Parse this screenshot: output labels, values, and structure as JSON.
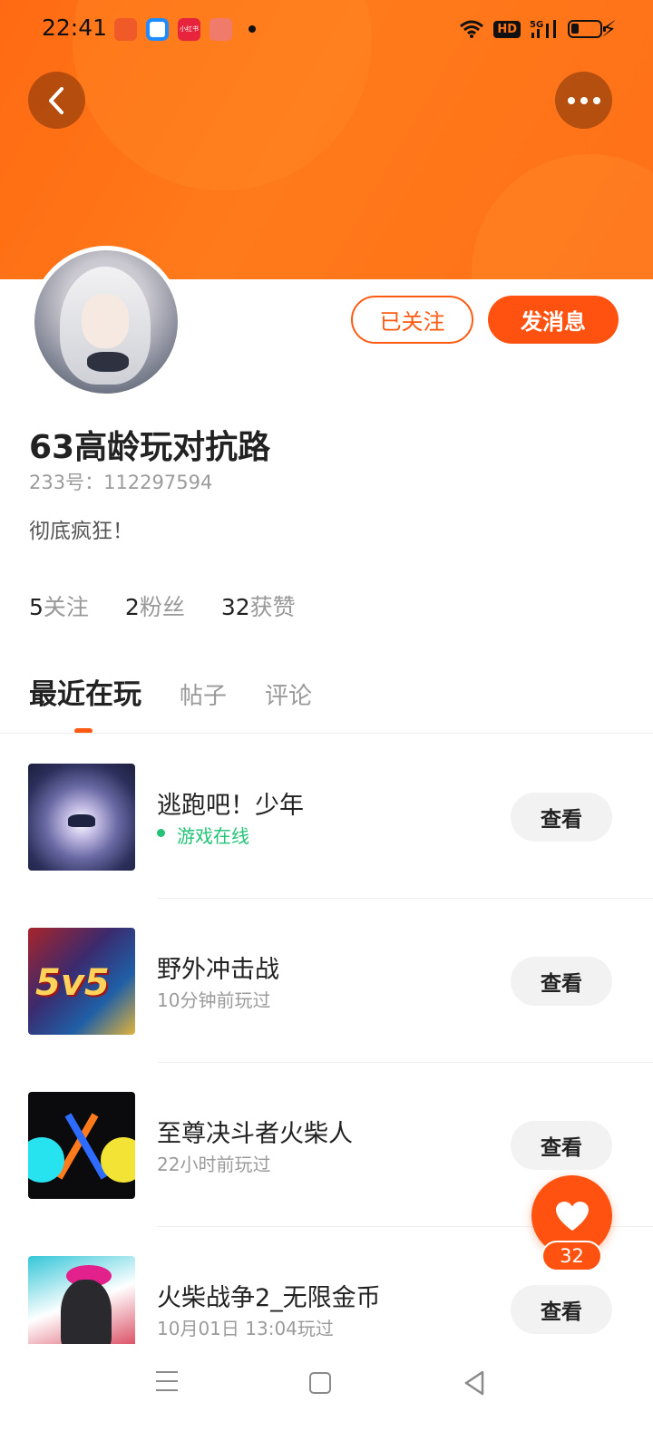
{
  "status_bar": {
    "time": "22:41",
    "notification_icons": [
      "kuaishou-icon",
      "browser-icon",
      "xiaohongshu-icon",
      "reader-icon"
    ],
    "notification_badge_text": "小红书",
    "hd_label": "HD",
    "network_label": "5G"
  },
  "header": {
    "back_icon": "chevron-left-icon",
    "more_icon": "more-dots-icon",
    "banner_color": "#ff7418"
  },
  "profile": {
    "username": "63高龄玩对抗路",
    "uid_text": "233号：112297594",
    "bio": "彻底疯狂！",
    "follow_button": "已关注",
    "message_button": "发消息",
    "stats": [
      {
        "num": "5",
        "label": "关注"
      },
      {
        "num": "2",
        "label": "粉丝"
      },
      {
        "num": "32",
        "label": "获赞"
      }
    ]
  },
  "tabs": [
    {
      "label": "最近在玩",
      "active": true
    },
    {
      "label": "帖子",
      "active": false
    },
    {
      "label": "评论",
      "active": false
    }
  ],
  "games": [
    {
      "title": "逃跑吧！少年",
      "subtitle": "游戏在线",
      "online": true,
      "button": "查看"
    },
    {
      "title": "野外冲击战",
      "subtitle": "10分钟前玩过",
      "online": false,
      "button": "查看",
      "thumb_text": "5v5"
    },
    {
      "title": "至尊决斗者火柴人",
      "subtitle": "22小时前玩过",
      "online": false,
      "button": "查看"
    },
    {
      "title": "火柴战争2_无限金币",
      "subtitle": "10月01日 13:04玩过",
      "online": false,
      "button": "查看"
    }
  ],
  "like_fab": {
    "icon": "heart-icon",
    "count": "32"
  },
  "colors": {
    "accent": "#ff5210",
    "online": "#22c377",
    "muted": "#9b9b9b"
  },
  "nav_bar": {
    "icons": [
      "menu-icon",
      "home-square-icon",
      "back-triangle-icon"
    ]
  }
}
